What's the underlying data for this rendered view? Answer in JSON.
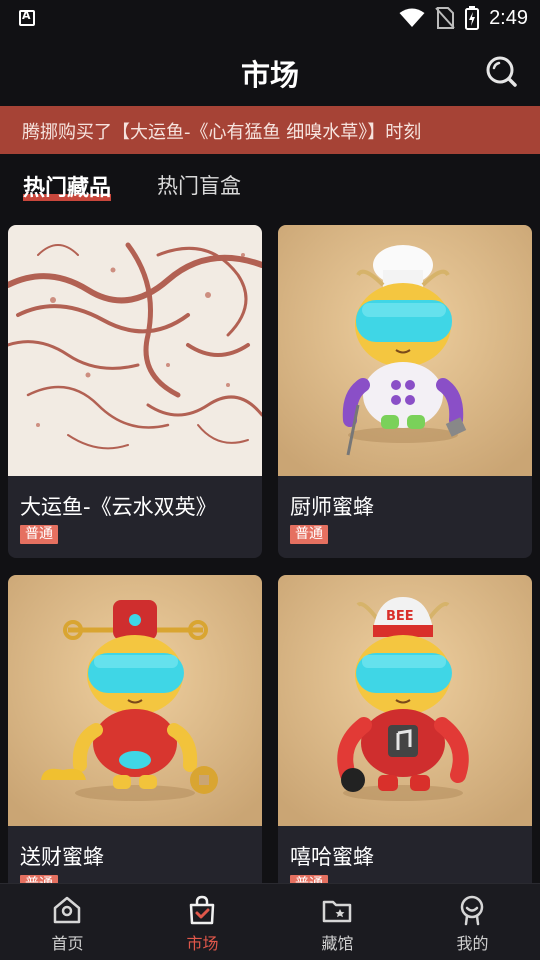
{
  "status_bar": {
    "app_indicator": "A",
    "time": "2:49"
  },
  "header": {
    "title": "市场",
    "search_icon": "search-icon"
  },
  "ticker": {
    "text": "腾挪购买了【大运鱼-《心有猛鱼 细嗅水草》】时刻"
  },
  "tabs": [
    {
      "label": "热门藏品",
      "active": true
    },
    {
      "label": "热门盲盒",
      "active": false
    }
  ],
  "cards": [
    {
      "name": "大运鱼-《云水双英》",
      "badge": "普通"
    },
    {
      "name": "厨师蜜蜂",
      "badge": "普通"
    },
    {
      "name": "送财蜜蜂",
      "badge": "普通"
    },
    {
      "name": "嘻哈蜜蜂",
      "badge": "普通"
    }
  ],
  "figure_text": {
    "cap_text": "BEE"
  },
  "bottom_nav": [
    {
      "label": "首页",
      "icon": "home-icon",
      "active": false
    },
    {
      "label": "市场",
      "icon": "shopping-bag-icon",
      "active": true
    },
    {
      "label": "藏馆",
      "icon": "folder-star-icon",
      "active": false
    },
    {
      "label": "我的",
      "icon": "profile-icon",
      "active": false
    }
  ],
  "colors": {
    "background": "#111114",
    "ticker_bg": "#a64336",
    "accent": "#e0574a",
    "card_bg": "#24242c",
    "badge_bg": "#e57060"
  }
}
